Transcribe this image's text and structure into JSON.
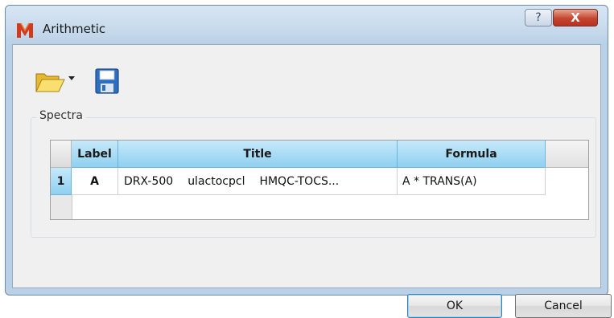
{
  "window": {
    "title": "Arithmetic",
    "help_glyph": "?",
    "close_glyph": "X"
  },
  "toolbar": {
    "open_icon": "folder-open-icon",
    "dropdown_icon": "dropdown-arrow-icon",
    "save_icon": "floppy-save-icon"
  },
  "spectra": {
    "group_label": "Spectra",
    "columns": [
      "Label",
      "Title",
      "Formula"
    ],
    "rows": [
      {
        "row_number": "1",
        "label": "A",
        "title_parts": [
          "DRX-500",
          "ulactocpcl",
          "HMQC-TOCS..."
        ],
        "formula": "A * TRANS(A)"
      }
    ]
  },
  "buttons": {
    "ok": "OK",
    "cancel": "Cancel"
  },
  "colors": {
    "selected_header": "#8fd0f0",
    "close_button": "#c4462f"
  }
}
